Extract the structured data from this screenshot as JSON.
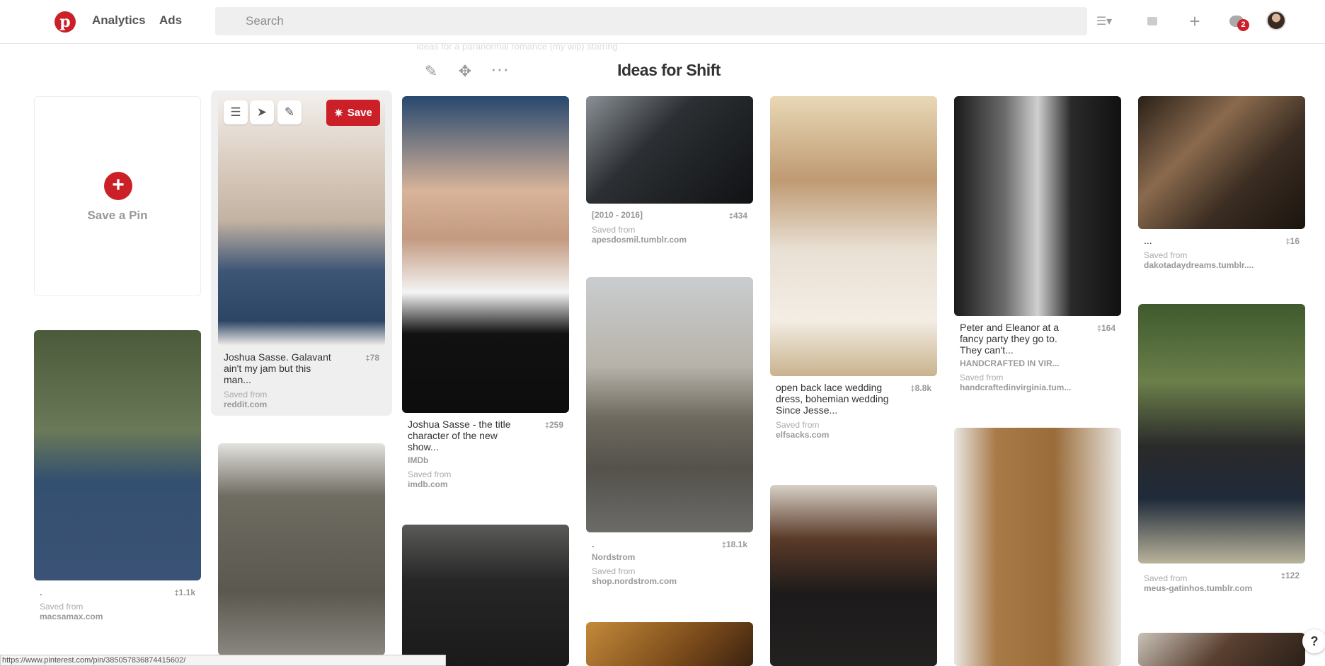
{
  "header": {
    "analytics": "Analytics",
    "ads": "Ads",
    "search_placeholder": "Search",
    "notifications_count": "2"
  },
  "board": {
    "title": "Ideas for Shift",
    "faded_line": "Ideas for a paranormal romance (my wip) starring"
  },
  "save_pin": {
    "label": "Save a Pin"
  },
  "hover": {
    "save_label": "Save"
  },
  "pins": [
    {
      "desc": "Joshua Sasse. Galavant ain't my jam but this man...",
      "count": "78",
      "saved": "Saved from",
      "source": "reddit.com"
    },
    {
      "desc": "Joshua Sasse - the title character of the new show...",
      "count": "259",
      "via": "IMDb",
      "saved": "Saved from",
      "source": "imdb.com"
    },
    {
      "desc": "[2010 - 2016]",
      "count": "434",
      "saved": "Saved from",
      "source": "apesdosmil.tumblr.com"
    },
    {
      "desc": ".",
      "count": "18.1k",
      "via": "Nordstrom",
      "saved": "Saved from",
      "source": "shop.nordstrom.com"
    },
    {
      "desc": "open back lace wedding dress, bohemian wedding Since Jesse...",
      "count": "8.8k",
      "saved": "Saved from",
      "source": "elfsacks.com"
    },
    {
      "desc": "Peter and Eleanor at a fancy party they go to. They can't...",
      "count": "164",
      "via": "HANDCRAFTED IN VIR...",
      "saved": "Saved from",
      "source": "handcraftedinvirginia.tum..."
    },
    {
      "desc": "...",
      "count": "16",
      "saved": "Saved from",
      "source": "dakotadaydreams.tumblr...."
    },
    {
      "desc": ".",
      "count": "1.1k",
      "saved": "Saved from",
      "source": "macsamax.com"
    },
    {
      "desc": "",
      "count": "122",
      "saved": "Saved from",
      "source": "meus-gatinhos.tumblr.com"
    }
  ],
  "status_url": "https://www.pinterest.com/pin/385057836874415602/",
  "help": "?"
}
